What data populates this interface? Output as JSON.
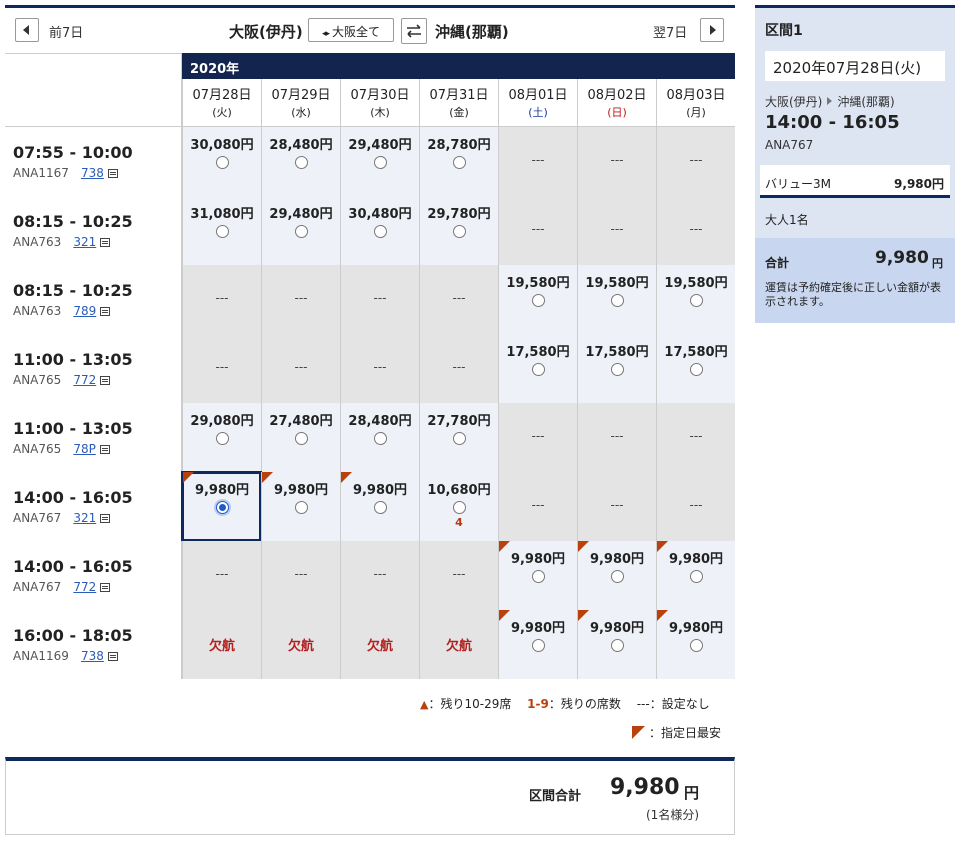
{
  "nav": {
    "prev_label": "前7日",
    "next_label": "翌7日",
    "origin": "大阪(伊丹)",
    "all_airports_button": "大阪全て",
    "destination": "沖縄(那覇)"
  },
  "grid": {
    "year": "2020年",
    "dates": [
      {
        "date": "07月28日",
        "weekday": "(火)"
      },
      {
        "date": "07月29日",
        "weekday": "(水)"
      },
      {
        "date": "07月30日",
        "weekday": "(木)"
      },
      {
        "date": "07月31日",
        "weekday": "(金)"
      },
      {
        "date": "08月01日",
        "weekday": "(土)"
      },
      {
        "date": "08月02日",
        "weekday": "(日)"
      },
      {
        "date": "08月03日",
        "weekday": "(月)"
      }
    ],
    "flights": [
      {
        "time": "07:55 - 10:00",
        "flight": "ANA1167",
        "equipment": "738",
        "cells": [
          {
            "price": "30,080円"
          },
          {
            "price": "28,480円"
          },
          {
            "price": "29,480円"
          },
          {
            "price": "28,780円"
          },
          {
            "na": "---"
          },
          {
            "na": "---"
          },
          {
            "na": "---"
          }
        ]
      },
      {
        "time": "08:15 - 10:25",
        "flight": "ANA763",
        "equipment": "321",
        "cells": [
          {
            "price": "31,080円"
          },
          {
            "price": "29,480円"
          },
          {
            "price": "30,480円"
          },
          {
            "price": "29,780円"
          },
          {
            "na": "---"
          },
          {
            "na": "---"
          },
          {
            "na": "---"
          }
        ]
      },
      {
        "time": "08:15 - 10:25",
        "flight": "ANA763",
        "equipment": "789",
        "cells": [
          {
            "na": "---"
          },
          {
            "na": "---"
          },
          {
            "na": "---"
          },
          {
            "na": "---"
          },
          {
            "price": "19,580円"
          },
          {
            "price": "19,580円"
          },
          {
            "price": "19,580円"
          }
        ]
      },
      {
        "time": "11:00 - 13:05",
        "flight": "ANA765",
        "equipment": "772",
        "cells": [
          {
            "na": "---"
          },
          {
            "na": "---"
          },
          {
            "na": "---"
          },
          {
            "na": "---"
          },
          {
            "price": "17,580円"
          },
          {
            "price": "17,580円"
          },
          {
            "price": "17,580円"
          }
        ]
      },
      {
        "time": "11:00 - 13:05",
        "flight": "ANA765",
        "equipment": "78P",
        "cells": [
          {
            "price": "29,080円"
          },
          {
            "price": "27,480円"
          },
          {
            "price": "28,480円"
          },
          {
            "price": "27,780円"
          },
          {
            "na": "---"
          },
          {
            "na": "---"
          },
          {
            "na": "---"
          }
        ]
      },
      {
        "time": "14:00 - 16:05",
        "flight": "ANA767",
        "equipment": "321",
        "cells": [
          {
            "price": "9,980円",
            "cheapest": true,
            "selected": true
          },
          {
            "price": "9,980円",
            "cheapest": true
          },
          {
            "price": "9,980円",
            "cheapest": true
          },
          {
            "price": "10,680円",
            "seats": "4"
          },
          {
            "na": "---"
          },
          {
            "na": "---"
          },
          {
            "na": "---"
          }
        ]
      },
      {
        "time": "14:00 - 16:05",
        "flight": "ANA767",
        "equipment": "772",
        "cells": [
          {
            "na": "---"
          },
          {
            "na": "---"
          },
          {
            "na": "---"
          },
          {
            "na": "---"
          },
          {
            "price": "9,980円",
            "cheapest": true
          },
          {
            "price": "9,980円",
            "cheapest": true
          },
          {
            "price": "9,980円",
            "cheapest": true
          }
        ]
      },
      {
        "time": "16:00 - 18:05",
        "flight": "ANA1169",
        "equipment": "738",
        "cells": [
          {
            "cancel": "欠航"
          },
          {
            "cancel": "欠航"
          },
          {
            "cancel": "欠航"
          },
          {
            "cancel": "欠航"
          },
          {
            "price": "9,980円",
            "cheapest": true
          },
          {
            "price": "9,980円",
            "cheapest": true
          },
          {
            "price": "9,980円",
            "cheapest": true
          }
        ]
      }
    ]
  },
  "legend": {
    "triangle": "▲",
    "triangle_text": "：残り10-29席",
    "seats_key": "1-9",
    "seats_text": "：残りの席数",
    "dash_text": "---：設定なし",
    "cheapest_text": "：指定日最安"
  },
  "total": {
    "label": "区間合計",
    "amount": "9,980",
    "unit": "円",
    "note": "(1名様分)"
  },
  "summary": {
    "section": "区間1",
    "date": "2020年07月28日(火)",
    "origin": "大阪(伊丹)",
    "destination": "沖縄(那覇)",
    "time": "14:00 - 16:05",
    "flight": "ANA767",
    "fare_type": "バリュー3M",
    "fare_price": "9,980円",
    "passengers": "大人1名",
    "total_label": "合計",
    "total_amount": "9,980",
    "total_unit": "円",
    "note": "運賃は予約確定後に正しい金額が表示されます。"
  },
  "colors": {
    "navy": "#0e2a5c",
    "cheapest_flag": "#b8410c",
    "cancel_red": "#b32020",
    "sunday_red": "#c01818",
    "saturday_blue": "#1a3a9a"
  }
}
